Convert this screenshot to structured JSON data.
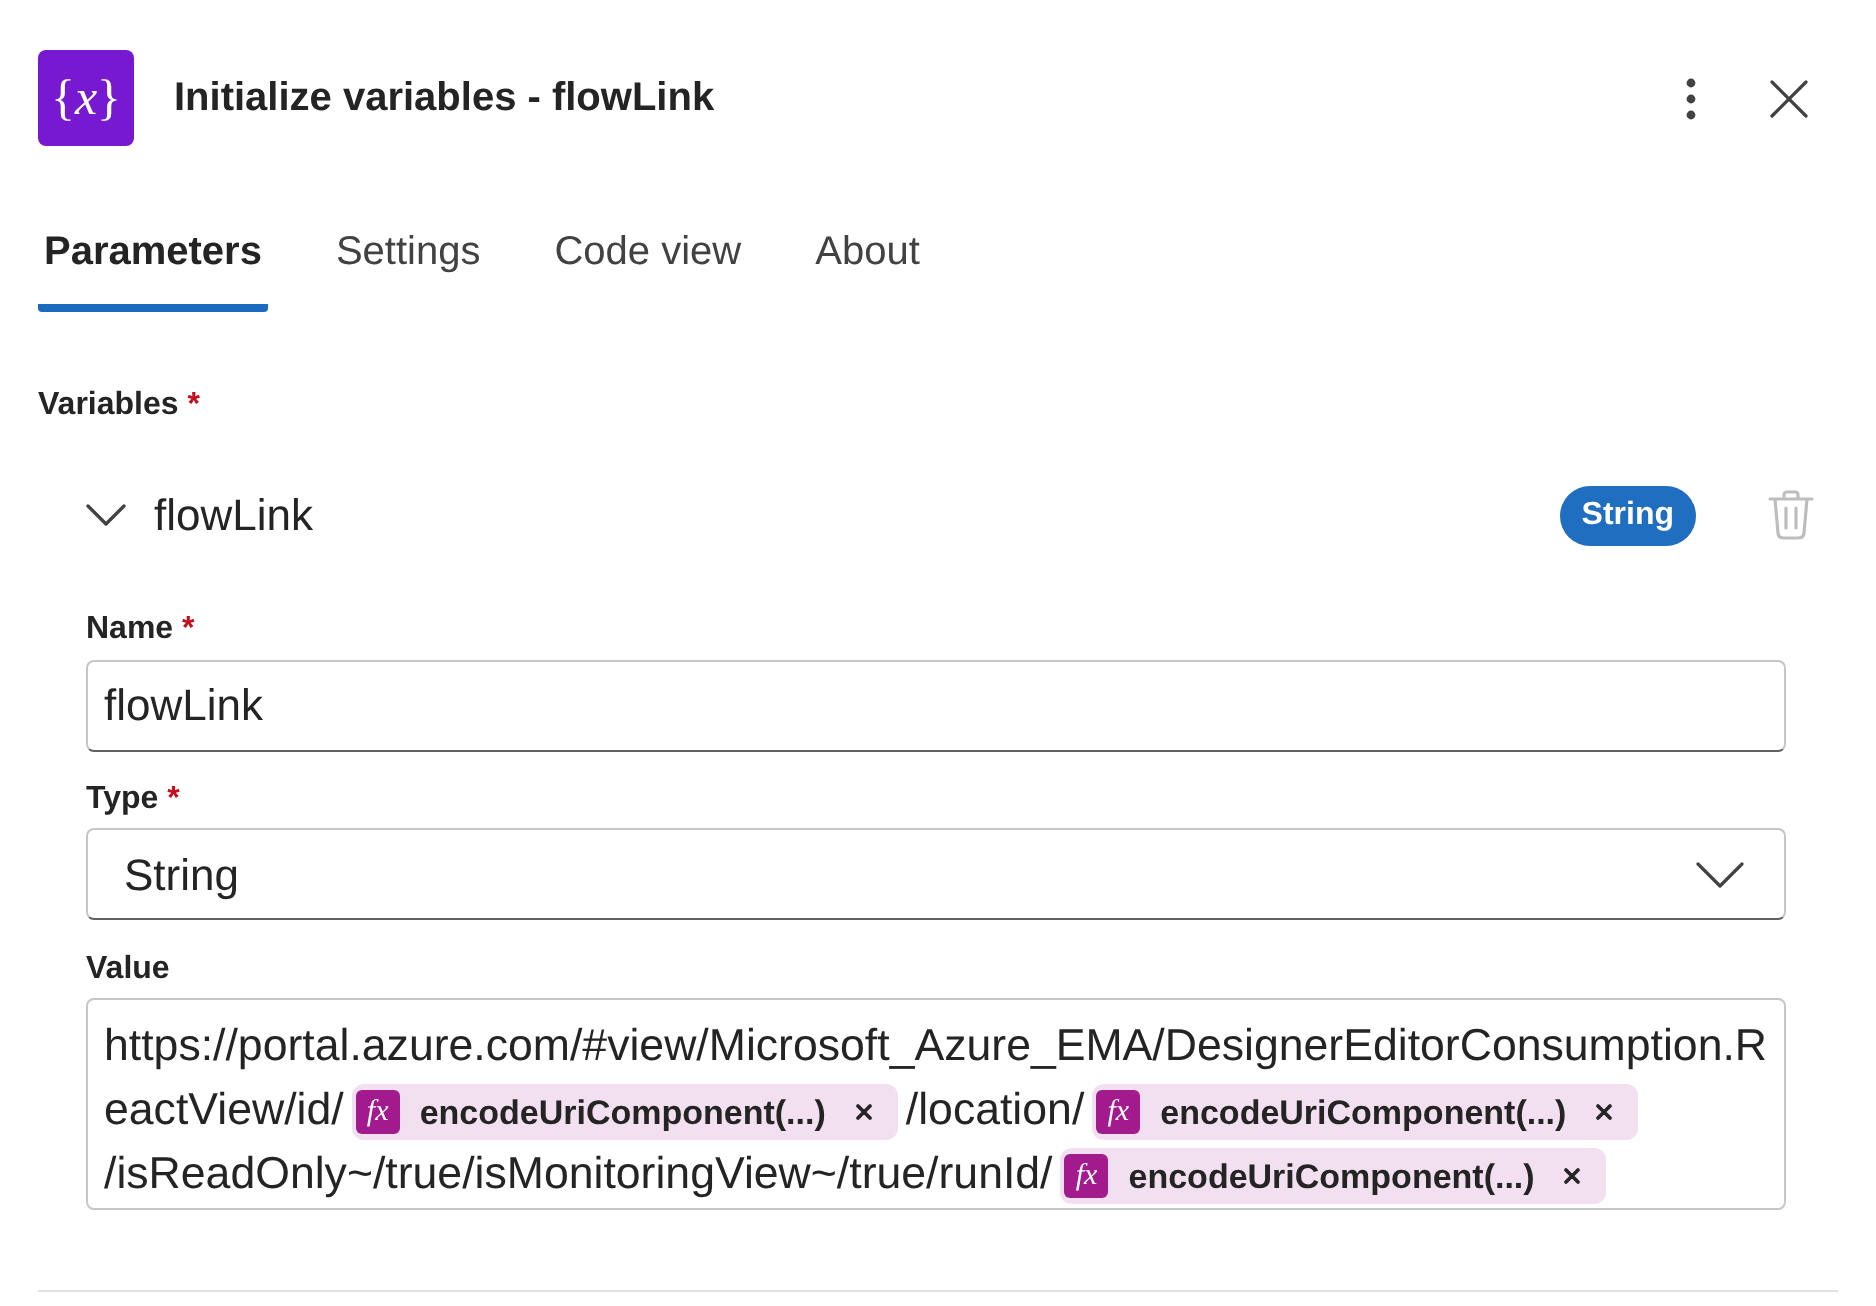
{
  "header": {
    "icon_glyph": "{*x*}",
    "title": "Initialize variables - flowLink"
  },
  "tabs": [
    {
      "label": "Parameters",
      "selected": true
    },
    {
      "label": "Settings",
      "selected": false
    },
    {
      "label": "Code view",
      "selected": false
    },
    {
      "label": "About",
      "selected": false
    }
  ],
  "variables_section": {
    "label": "Variables",
    "required_mark": "*",
    "variables": [
      {
        "name": "flowLink",
        "expanded": true,
        "type_badge": "String",
        "delete_disabled": true,
        "fields": [
          {
            "kind": "text",
            "label": "Name",
            "required_mark": "*",
            "value": "flowLink"
          },
          {
            "kind": "dropdown",
            "label": "Type",
            "required_mark": "*",
            "value": "String"
          },
          {
            "kind": "expression",
            "label": "Value",
            "segments": [
              {
                "kind": "text",
                "text": "https://portal.azure.com/#view/Microsoft_Azure_EMA/DesignerEditorConsumption.R"
              },
              {
                "kind": "text",
                "text": "eactView/id/"
              },
              {
                "kind": "token",
                "icon_text": "fx",
                "label": "encodeUriComponent(...)"
              },
              {
                "kind": "text",
                "text": "/location/"
              },
              {
                "kind": "token",
                "icon_text": "fx",
                "label": "encodeUriComponent(...)"
              },
              {
                "kind": "text",
                "text": "/isReadOnly~/true/isMonitoringView~/true/runId/"
              },
              {
                "kind": "token",
                "icon_text": "fx",
                "label": "encodeUriComponent(...)"
              }
            ]
          }
        ]
      }
    ]
  }
}
